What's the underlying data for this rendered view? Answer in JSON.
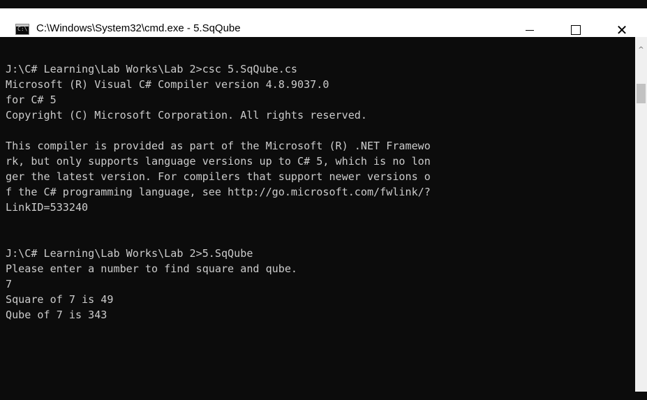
{
  "window": {
    "title": "C:\\Windows\\System32\\cmd.exe - 5.SqQube",
    "icon": "cmd-icon",
    "icon_text": "C:\\",
    "minimize_symbol": "—",
    "maximize_symbol": "☐",
    "close_symbol": "✕"
  },
  "console": {
    "lines": [
      "J:\\C# Learning\\Lab Works\\Lab 2>csc 5.SqQube.cs",
      "Microsoft (R) Visual C# Compiler version 4.8.9037.0",
      "for C# 5",
      "Copyright (C) Microsoft Corporation. All rights reserved.",
      "",
      "This compiler is provided as part of the Microsoft (R) .NET Framewo",
      "rk, but only supports language versions up to C# 5, which is no lon",
      "ger the latest version. For compilers that support newer versions o",
      "f the C# programming language, see http://go.microsoft.com/fwlink/?",
      "LinkID=533240",
      "",
      "",
      "J:\\C# Learning\\Lab Works\\Lab 2>5.SqQube",
      "Please enter a number to find square and qube.",
      "7",
      "Square of 7 is 49",
      "Qube of 7 is 343"
    ],
    "foreground": "#cccccc",
    "background": "#0c0c0c"
  },
  "scrollbar": {
    "up_arrow": "^"
  }
}
